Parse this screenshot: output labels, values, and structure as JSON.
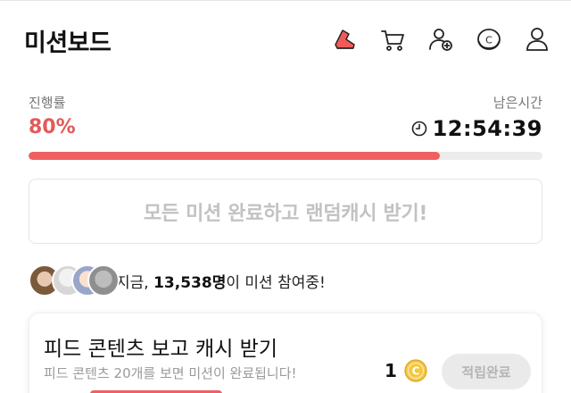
{
  "header": {
    "title": "미션보드",
    "icons": [
      "mission-shoe-icon",
      "cart-icon",
      "add-user-icon",
      "cash-coin-icon",
      "profile-icon"
    ]
  },
  "progress": {
    "label": "진행률",
    "value_text": "80%",
    "fraction": 0.8,
    "time_label": "남은시간",
    "time_remaining": "12:54:39",
    "accent_color": "#f06060"
  },
  "reward_banner": {
    "text": "모든 미션 완료하고 랜덤캐시 받기!"
  },
  "participants": {
    "prefix": "지금, ",
    "count": "13,538명",
    "suffix": "이 미션 참여중!"
  },
  "mission": {
    "title": "피드 콘텐츠 보고 캐시 받기",
    "description": "피드 콘텐츠 20개를 보면 미션이 완료됩니다!",
    "reward": "1",
    "button_label": "적립완료"
  }
}
